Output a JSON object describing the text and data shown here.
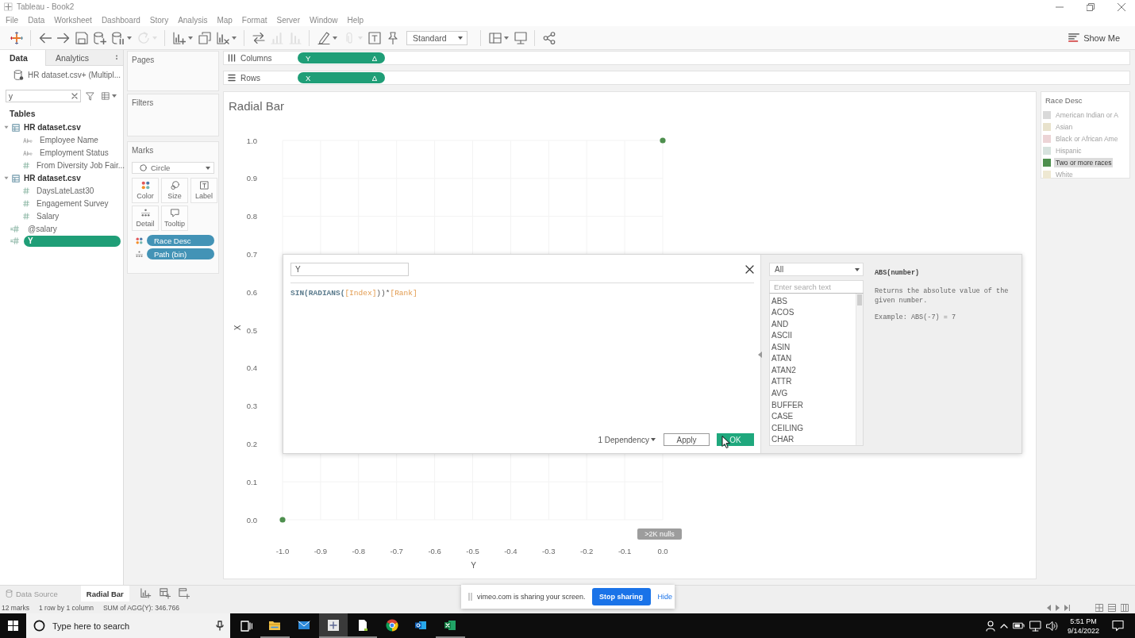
{
  "window": {
    "title": "Tableau - Book2"
  },
  "menu": [
    "File",
    "Data",
    "Worksheet",
    "Dashboard",
    "Story",
    "Analysis",
    "Map",
    "Format",
    "Server",
    "Window",
    "Help"
  ],
  "toolbar": {
    "items": [
      {
        "kind": "logo",
        "disabled": false,
        "menu": false
      },
      {
        "kind": "separator"
      },
      {
        "kind": "back",
        "disabled": false,
        "menu": false
      },
      {
        "kind": "forward",
        "disabled": false,
        "menu": false
      },
      {
        "kind": "save",
        "disabled": false,
        "menu": false
      },
      {
        "kind": "add_source",
        "disabled": false,
        "menu": false
      },
      {
        "kind": "pause",
        "disabled": false,
        "menu": true
      },
      {
        "kind": "refresh",
        "disabled": true,
        "menu": true
      },
      {
        "kind": "separator"
      },
      {
        "kind": "new_sheet",
        "disabled": false,
        "menu": true
      },
      {
        "kind": "duplicate",
        "disabled": false,
        "menu": false
      },
      {
        "kind": "clear",
        "disabled": false,
        "menu": true
      },
      {
        "kind": "separator"
      },
      {
        "kind": "swap",
        "disabled": false,
        "menu": false
      },
      {
        "kind": "sort_asc",
        "disabled": true,
        "menu": false
      },
      {
        "kind": "sort_desc",
        "disabled": true,
        "menu": false
      },
      {
        "kind": "separator"
      },
      {
        "kind": "highlight",
        "disabled": false,
        "menu": true
      },
      {
        "kind": "group",
        "disabled": true,
        "menu": true
      },
      {
        "kind": "labels",
        "disabled": false,
        "menu": false
      },
      {
        "kind": "pin",
        "disabled": false,
        "menu": false
      },
      {
        "kind": "select",
        "value": "Standard"
      },
      {
        "kind": "separator"
      },
      {
        "kind": "cards",
        "disabled": false,
        "menu": true
      },
      {
        "kind": "present",
        "disabled": false,
        "menu": false
      },
      {
        "kind": "separator"
      },
      {
        "kind": "share",
        "disabled": false,
        "menu": false
      }
    ],
    "show_me": "Show Me"
  },
  "data_pane": {
    "tabs": [
      {
        "label": "Data",
        "selected": true
      },
      {
        "label": "Analytics",
        "selected": false
      }
    ],
    "source": "HR dataset.csv+ (Multipl...",
    "search": {
      "value": "y"
    },
    "heading": "Tables",
    "tree": [
      {
        "kind": "table",
        "label": "HR dataset.csv",
        "expanded": true,
        "selected": false,
        "children": [
          {
            "kind": "text",
            "label": "Employee Name",
            "selected": false
          },
          {
            "kind": "text",
            "label": "Employment Status",
            "selected": false
          },
          {
            "kind": "number",
            "label": "From Diversity Job Fair...",
            "selected": false
          }
        ]
      },
      {
        "kind": "table",
        "label": "HR dataset.csv",
        "expanded": true,
        "selected": false,
        "children": [
          {
            "kind": "number",
            "label": "DaysLateLast30",
            "selected": false
          },
          {
            "kind": "number",
            "label": "Engagement Survey",
            "selected": false
          },
          {
            "kind": "number",
            "label": "Salary",
            "selected": false
          }
        ]
      },
      {
        "kind": "calculated",
        "label": "@salary",
        "selected": false
      },
      {
        "kind": "calculated",
        "label": "Y",
        "selected": true
      }
    ]
  },
  "cards": {
    "pages": {
      "title": "Pages"
    },
    "filters": {
      "title": "Filters"
    },
    "marks": {
      "title": "Marks",
      "mark_type": "Circle",
      "buttons": [
        {
          "kind": "color",
          "label": "Color"
        },
        {
          "kind": "size",
          "label": "Size"
        },
        {
          "kind": "label",
          "label": "Label"
        },
        {
          "kind": "detail",
          "label": "Detail"
        },
        {
          "kind": "tooltip",
          "label": "Tooltip"
        }
      ],
      "pills": [
        {
          "kind": "color",
          "label": "Race Desc"
        },
        {
          "kind": "detail",
          "label": "Path (bin)"
        }
      ]
    }
  },
  "shelves": [
    {
      "kind": "columns",
      "label": "Columns",
      "pill": {
        "label": "Y",
        "marker": "Δ"
      }
    },
    {
      "kind": "rows",
      "label": "Rows",
      "pill": {
        "label": "X",
        "marker": "Δ"
      }
    }
  ],
  "view": {
    "title": "Radial Bar",
    "nulls_indicator": ">2K nulls",
    "chart_data": {
      "type": "scatter",
      "xlabel": "Y",
      "ylabel": "X",
      "x": [
        -1.0,
        0.0
      ],
      "series": [
        {
          "color": "#4e8f4e",
          "values": [
            0.0,
            1.0
          ]
        }
      ],
      "xlim": [
        -1.0,
        0.0
      ],
      "ylim": [
        0.0,
        1.0
      ],
      "grid": true,
      "xticks": [
        {
          "value": -1.0,
          "label": "-1.0"
        },
        -0.9,
        -0.8,
        -0.7,
        -0.6,
        -0.5,
        -0.4,
        -0.3,
        -0.2,
        -0.1,
        {
          "value": 0.0,
          "label": "0.0"
        }
      ],
      "yticks": [
        {
          "value": 0.0,
          "label": "0.0"
        },
        0.1,
        0.2,
        0.3,
        0.4,
        0.5,
        0.6,
        0.7,
        0.8,
        0.9,
        {
          "value": 1.0,
          "label": "1.0"
        }
      ]
    }
  },
  "legend": {
    "title": "Race Desc",
    "items": [
      {
        "label": "American Indian or A",
        "color": "#d9d9d9",
        "selected": false
      },
      {
        "label": "Asian",
        "color": "#e8e2cc",
        "selected": false
      },
      {
        "label": "Black or African Ame",
        "color": "#ecd4d6",
        "selected": false
      },
      {
        "label": "Hispanic",
        "color": "#d6e2dd",
        "selected": false
      },
      {
        "label": "Two or more races",
        "color": "#4e8f4e",
        "selected": true
      },
      {
        "label": "White",
        "color": "#eee8d2",
        "selected": false
      }
    ]
  },
  "calc_dialog": {
    "name": "Y",
    "formula": [
      {
        "kind": "function",
        "text": "SIN(RADIANS("
      },
      {
        "kind": "field",
        "text": "[Index]"
      },
      {
        "kind": "operator",
        "text": "))*"
      },
      {
        "kind": "field",
        "text": "[Rank]"
      }
    ],
    "dependency": "1 Dependency",
    "buttons": [
      {
        "kind": "secondary",
        "label": "Apply"
      },
      {
        "kind": "primary",
        "label": "OK"
      }
    ],
    "functions_panel": {
      "category": "All",
      "search_placeholder": "Enter search text",
      "functions": [
        "ABS",
        "ACOS",
        "AND",
        "ASCII",
        "ASIN",
        "ATAN",
        "ATAN2",
        "ATTR",
        "AVG",
        "BUFFER",
        "CASE",
        "CEILING",
        "CHAR"
      ],
      "help": {
        "signature": "ABS(number)",
        "description": "Returns the absolute value of the given number.",
        "example": "Example: ABS(-7) = 7"
      }
    }
  },
  "sheet_tabs": [
    {
      "kind": "data_source",
      "label": "Data Source",
      "selected": false
    },
    {
      "kind": "sheet",
      "label": "Radial Bar",
      "selected": true
    }
  ],
  "share_bar": {
    "message": "vimeo.com is sharing your screen.",
    "stop": "Stop sharing",
    "hide": "Hide"
  },
  "status_bar": [
    "12 marks",
    "1 row by 1 column",
    "SUM of AGG(Y): 346.766"
  ],
  "taskbar": {
    "search_placeholder": "Type here to search",
    "apps": [
      {
        "kind": "explorer",
        "active": false,
        "running": true
      },
      {
        "kind": "mail",
        "active": false,
        "running": false
      },
      {
        "kind": "tableau",
        "active": true,
        "running": true
      },
      {
        "kind": "notepad",
        "active": false,
        "running": true
      },
      {
        "kind": "chrome",
        "active": false,
        "running": false
      },
      {
        "kind": "outlook",
        "active": false,
        "running": false
      },
      {
        "kind": "excel",
        "active": false,
        "running": true
      }
    ],
    "time": "5:51 PM",
    "date": "9/14/2022"
  }
}
